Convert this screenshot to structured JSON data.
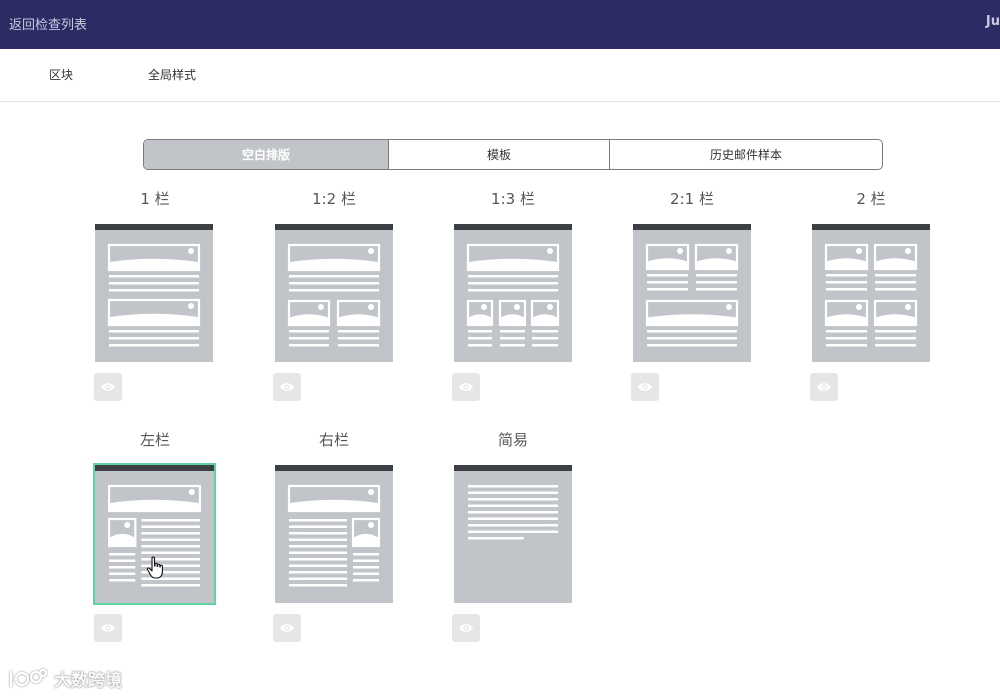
{
  "topbar": {
    "back_label": "返回检查列表",
    "user_label": "Ju"
  },
  "subnav": {
    "tabs": [
      {
        "label": "区块"
      },
      {
        "label": "全局样式"
      }
    ]
  },
  "segmented": {
    "options": [
      {
        "label": "空白排版"
      },
      {
        "label": "模板"
      },
      {
        "label": "历史邮件样本"
      }
    ],
    "active_index": 0
  },
  "templates": [
    {
      "title": "1 栏",
      "layout": "one-col",
      "selected": false
    },
    {
      "title": "1:2 栏",
      "layout": "one-two",
      "selected": false
    },
    {
      "title": "1:3 栏",
      "layout": "one-three",
      "selected": false
    },
    {
      "title": "2:1 栏",
      "layout": "two-one",
      "selected": false
    },
    {
      "title": "2 栏",
      "layout": "two-col",
      "selected": false
    },
    {
      "title": "左栏",
      "layout": "left-sidebar",
      "selected": true
    },
    {
      "title": "右栏",
      "layout": "right-sidebar",
      "selected": false
    },
    {
      "title": "简易",
      "layout": "simple",
      "selected": false
    }
  ],
  "icons": {
    "preview": "eye-icon",
    "cursor": "hand-pointer-icon",
    "watermark_logo": "logo-icon"
  },
  "colors": {
    "topbar": "#2b2c63",
    "thumb": "#c1c5c9",
    "selected_border": "#5fd3a3",
    "active_segment": "#c1c5c9"
  },
  "watermark": {
    "text": "大数跨境"
  }
}
